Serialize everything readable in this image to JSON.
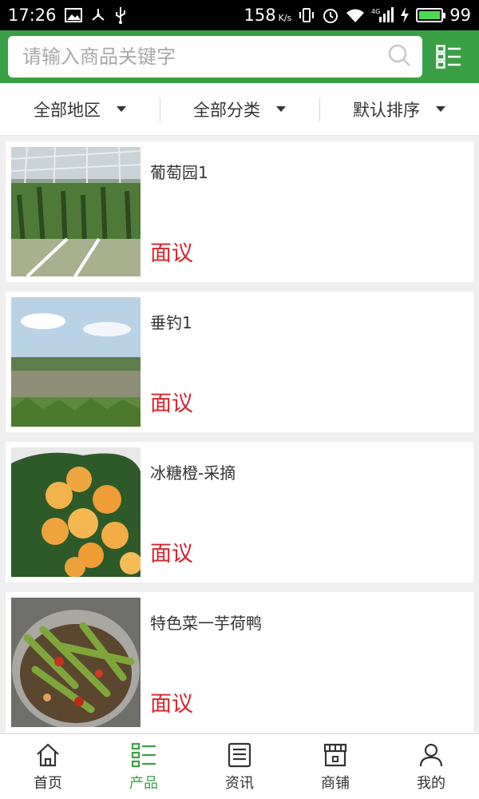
{
  "status_bar": {
    "time": "17:26",
    "network_speed": "158",
    "speed_unit": "K/s",
    "signal_label": "4G",
    "battery": "99"
  },
  "search": {
    "placeholder": "请输入商品关键字",
    "value": ""
  },
  "filters": [
    {
      "label": "全部地区"
    },
    {
      "label": "全部分类"
    },
    {
      "label": "默认排序"
    }
  ],
  "products": [
    {
      "title": "葡萄园1",
      "price": "面议",
      "image": "greenhouse-photo"
    },
    {
      "title": "垂钓1",
      "price": "面议",
      "image": "fishing-pond-photo"
    },
    {
      "title": "冰糖橙-采摘",
      "price": "面议",
      "image": "orange-tree-photo"
    },
    {
      "title": "特色菜一芋荷鸭",
      "price": "面议",
      "image": "duck-dish-photo"
    }
  ],
  "tabs": [
    {
      "label": "首页",
      "icon": "home-icon"
    },
    {
      "label": "产品",
      "icon": "list-icon",
      "active": true
    },
    {
      "label": "资讯",
      "icon": "news-icon"
    },
    {
      "label": "商铺",
      "icon": "shop-icon"
    },
    {
      "label": "我的",
      "icon": "user-icon"
    }
  ],
  "colors": {
    "brand": "#3aa046",
    "price": "#d9232d"
  }
}
